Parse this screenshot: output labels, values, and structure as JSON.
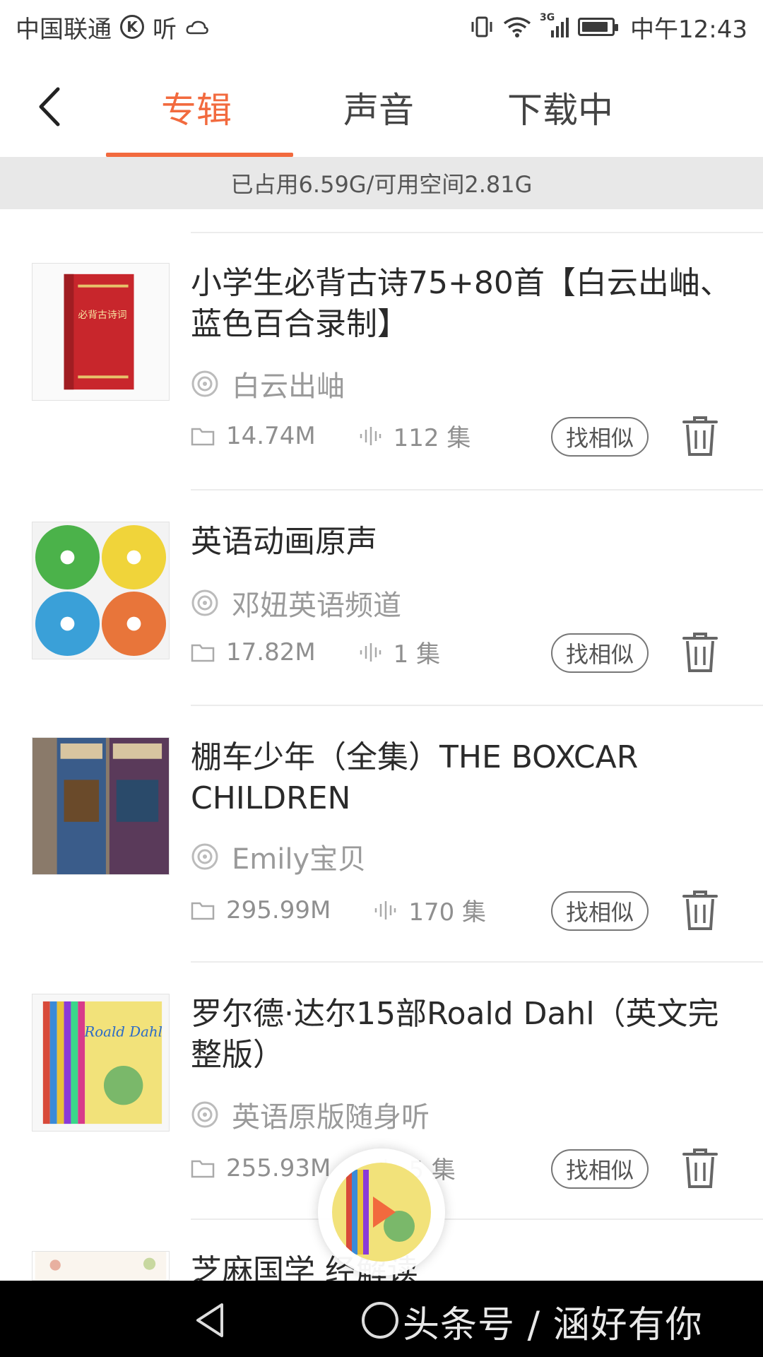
{
  "status_bar": {
    "carrier": "中国联通",
    "k_label": "K",
    "listen": "听",
    "network": "3G",
    "time": "中午12:43"
  },
  "tabs": [
    {
      "label": "专辑",
      "active": true
    },
    {
      "label": "声音",
      "active": false
    },
    {
      "label": "下载中",
      "active": false
    }
  ],
  "storage_text": "已占用6.59G/可用空间2.81G",
  "albums": [
    {
      "title": "小学生必背古诗75+80首【白云出岫、蓝色百合录制】",
      "author": "白云出岫",
      "size": "14.74M",
      "episodes": "112 集",
      "similar_label": "找相似",
      "cover_text": "必背古诗词"
    },
    {
      "title": "英语动画原声",
      "author": "邓妞英语频道",
      "size": "17.82M",
      "episodes": "1 集",
      "similar_label": "找相似"
    },
    {
      "title": "棚车少年（全集）THE BOXCAR CHILDREN",
      "author": "Emily宝贝",
      "size": "295.99M",
      "episodes": "170 集",
      "similar_label": "找相似"
    },
    {
      "title": "罗尔德·达尔15部Roald Dahl（英文完整版）",
      "author": "英语原版随身听",
      "size": "255.93M",
      "episodes": "5 集",
      "similar_label": "找相似",
      "cover_text": "Roald Dahl"
    },
    {
      "title": "芝麻国学              经解读"
    }
  ],
  "watermark": "头条号 / 涵好有你",
  "colors": {
    "accent": "#f26a3e",
    "storage_bg": "#e8e8e8",
    "sysbar": "#000000"
  }
}
